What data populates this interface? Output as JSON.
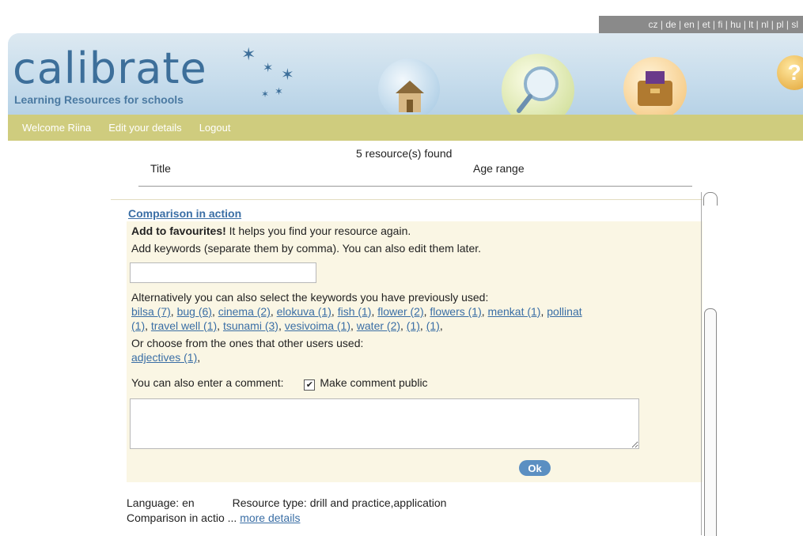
{
  "header": {
    "languages": "cz | de | en | et | fi | hu | lt | nl | pl | sl",
    "logo_text": "calibrate",
    "logo_tagline": "Learning Resources for schools",
    "help_icon": "?"
  },
  "nav": {
    "welcome": "Welcome Riina",
    "edit_details": "Edit your details",
    "logout": "Logout"
  },
  "results": {
    "count_text": "5 resource(s) found",
    "col_title": "Title",
    "col_age": "Age range"
  },
  "resource": {
    "title": "Comparison in action",
    "fav_bold": "Add to favourites!",
    "fav_rest": " It helps you find your resource again.",
    "keywords_instruction": "Add keywords (separate them by comma). You can also edit them later.",
    "keywords_input_value": "",
    "previous_label": "Alternatively you can also select the keywords you have previously used:",
    "previous_keywords": [
      "bilsa (7)",
      "bug (6)",
      "cinema (2)",
      "elokuva (1)",
      "fish (1)",
      "flower (2)",
      "flowers (1)",
      "menkat (1)",
      "pollinat"
    ],
    "previous_keywords_line2": [
      "(1)",
      "travel well (1)",
      "tsunami (3)",
      "vesivoima (1)",
      "water (2)",
      "(1)",
      "(1)"
    ],
    "others_label": "Or choose from the ones that other users used:",
    "others_keywords": [
      "adjectives (1)"
    ],
    "comment_label": "You can also enter a comment:",
    "public_label": "Make comment public",
    "public_checked": "✔",
    "comment_value": "",
    "ok_label": "Ok",
    "language_text": "Language: en",
    "resource_type_text": "Resource type: drill and practice,application",
    "desc_text": "Comparison in actio ...",
    "more_details": "more details"
  },
  "colors": {
    "nav_bar": "#cfcc7e",
    "panel": "#faf6e4",
    "link": "#3a6ea5",
    "logo": "#3d6f9a"
  },
  "icons": [
    "house-icon",
    "magnifier-icon",
    "briefcase-icon",
    "help-icon",
    "star-icon"
  ]
}
